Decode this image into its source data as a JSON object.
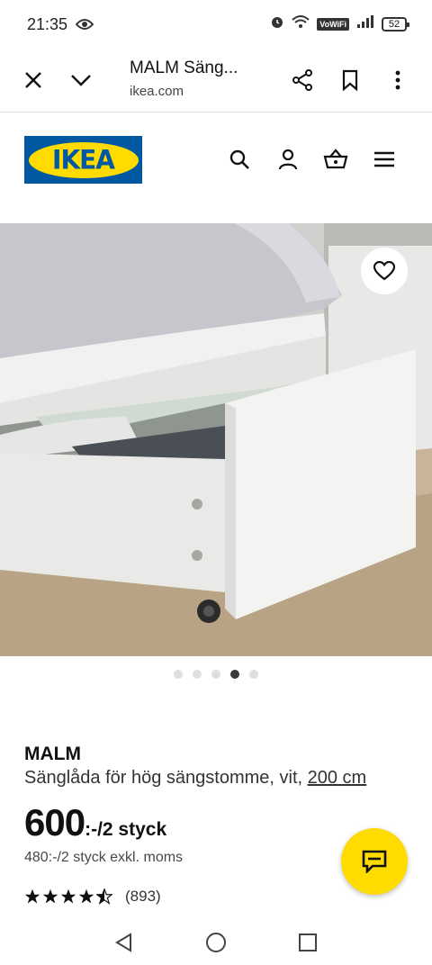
{
  "status_bar": {
    "time": "21:35",
    "battery": "52",
    "vowifi": "VoWiFi"
  },
  "browser": {
    "title": "MALM Säng...",
    "url": "ikea.com"
  },
  "header": {
    "logo_text": "IKEA"
  },
  "carousel": {
    "count": 5,
    "active_index": 3
  },
  "product": {
    "name": "MALM",
    "description": "Sänglåda för hög sängstomme, vit,",
    "size_link": "200 cm",
    "price_main": "600",
    "price_suffix": ":-/2 styck",
    "price_excl": "480:-/2 styck exkl. moms",
    "rating_value": 4.5,
    "rating_count": "(893)"
  },
  "colors": {
    "ikea_blue": "#0058a3",
    "ikea_yellow": "#ffdb00"
  }
}
